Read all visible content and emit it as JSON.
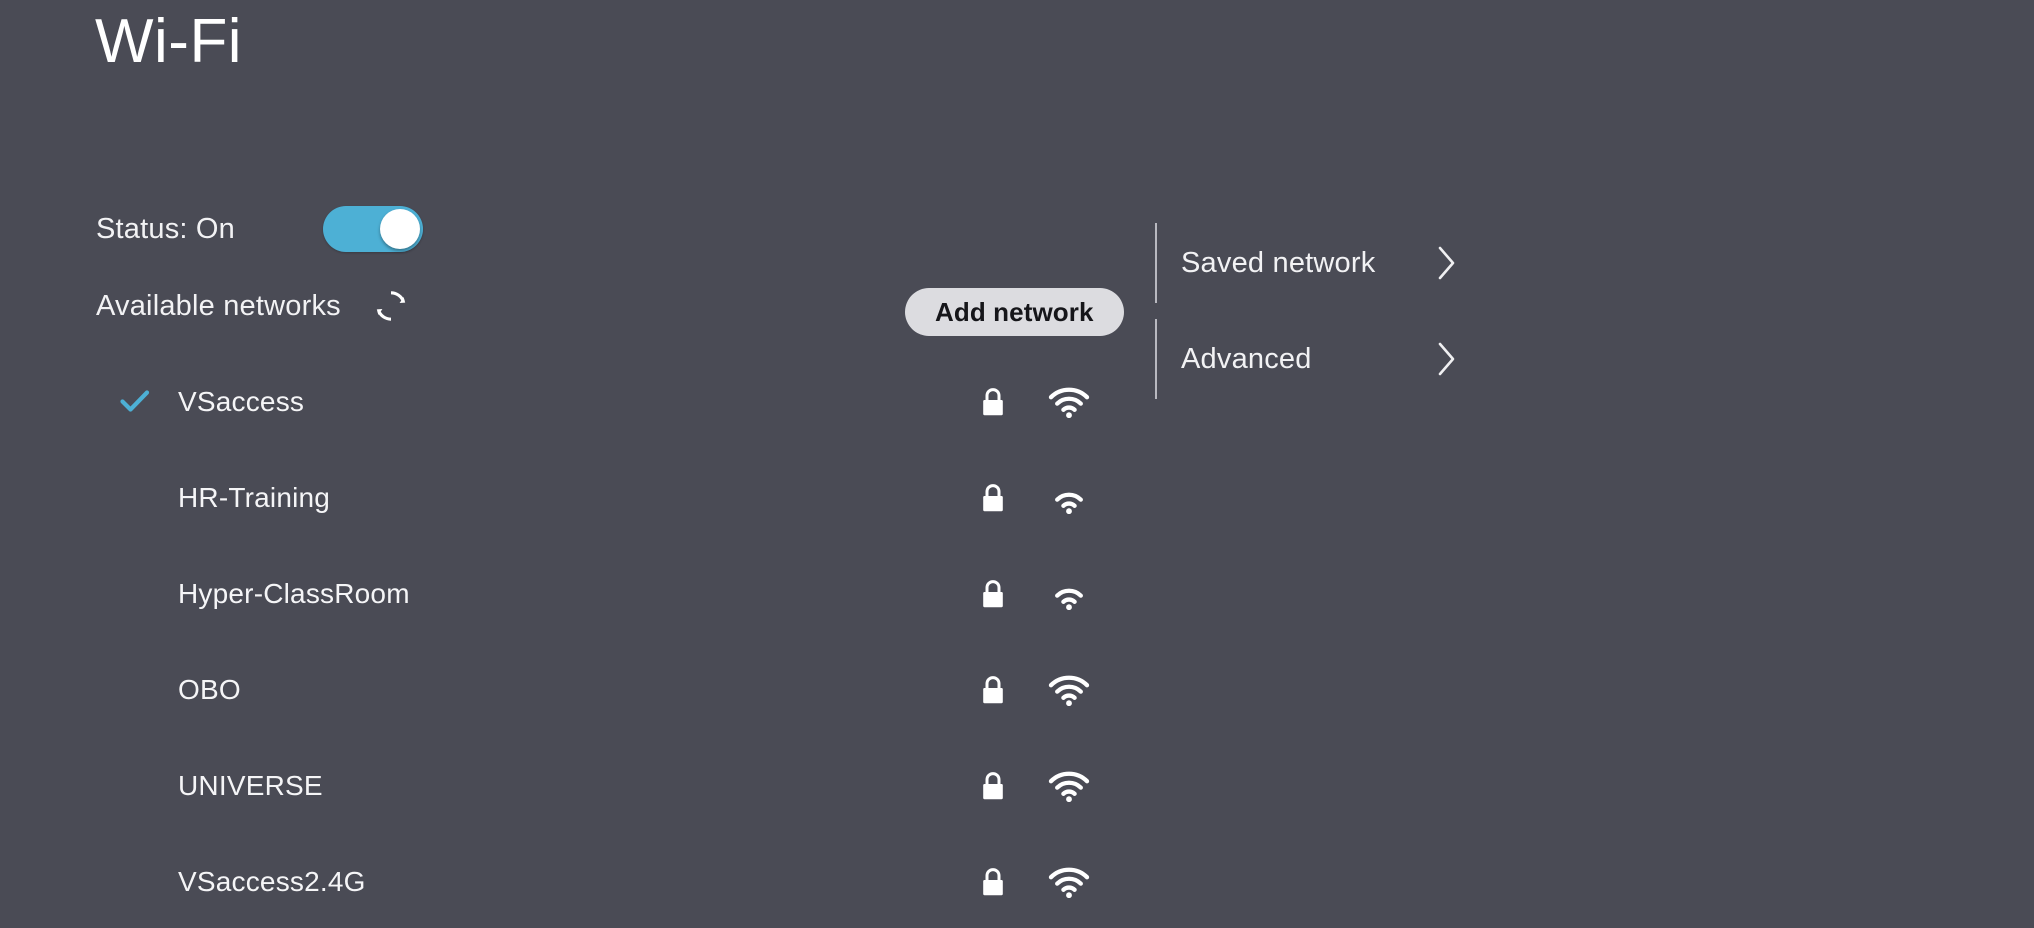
{
  "page": {
    "title": "Wi-Fi",
    "background_color": "#4a4b55",
    "accent_color": "#4db0d5"
  },
  "status": {
    "label": "Status: On",
    "toggle_state": "on",
    "toggle_color": "#4db0d5"
  },
  "available": {
    "label": "Available networks",
    "refresh_icon": "refresh-icon"
  },
  "add_network": {
    "label": "Add network",
    "background_color": "#dcdce0",
    "text_color": "#16161a"
  },
  "networks": [
    {
      "ssid": "VSaccess",
      "connected": true,
      "secured": true,
      "signal": 3,
      "lock_icon": "lock-icon",
      "signal_icon": "wifi-icon"
    },
    {
      "ssid": "HR-Training",
      "connected": false,
      "secured": true,
      "signal": 2,
      "lock_icon": "lock-icon",
      "signal_icon": "wifi-icon"
    },
    {
      "ssid": "Hyper-ClassRoom",
      "connected": false,
      "secured": true,
      "signal": 2,
      "lock_icon": "lock-icon",
      "signal_icon": "wifi-icon"
    },
    {
      "ssid": "OBO",
      "connected": false,
      "secured": true,
      "signal": 3,
      "lock_icon": "lock-icon",
      "signal_icon": "wifi-icon"
    },
    {
      "ssid": "UNIVERSE",
      "connected": false,
      "secured": true,
      "signal": 3,
      "lock_icon": "lock-icon",
      "signal_icon": "wifi-icon"
    },
    {
      "ssid": "VSaccess2.4G",
      "connected": false,
      "secured": true,
      "signal": 3,
      "lock_icon": "lock-icon",
      "signal_icon": "wifi-icon"
    }
  ],
  "right_panel": {
    "items": [
      {
        "label": "Saved network",
        "chevron_icon": "chevron-right-icon"
      },
      {
        "label": "Advanced",
        "chevron_icon": "chevron-right-icon"
      }
    ]
  }
}
